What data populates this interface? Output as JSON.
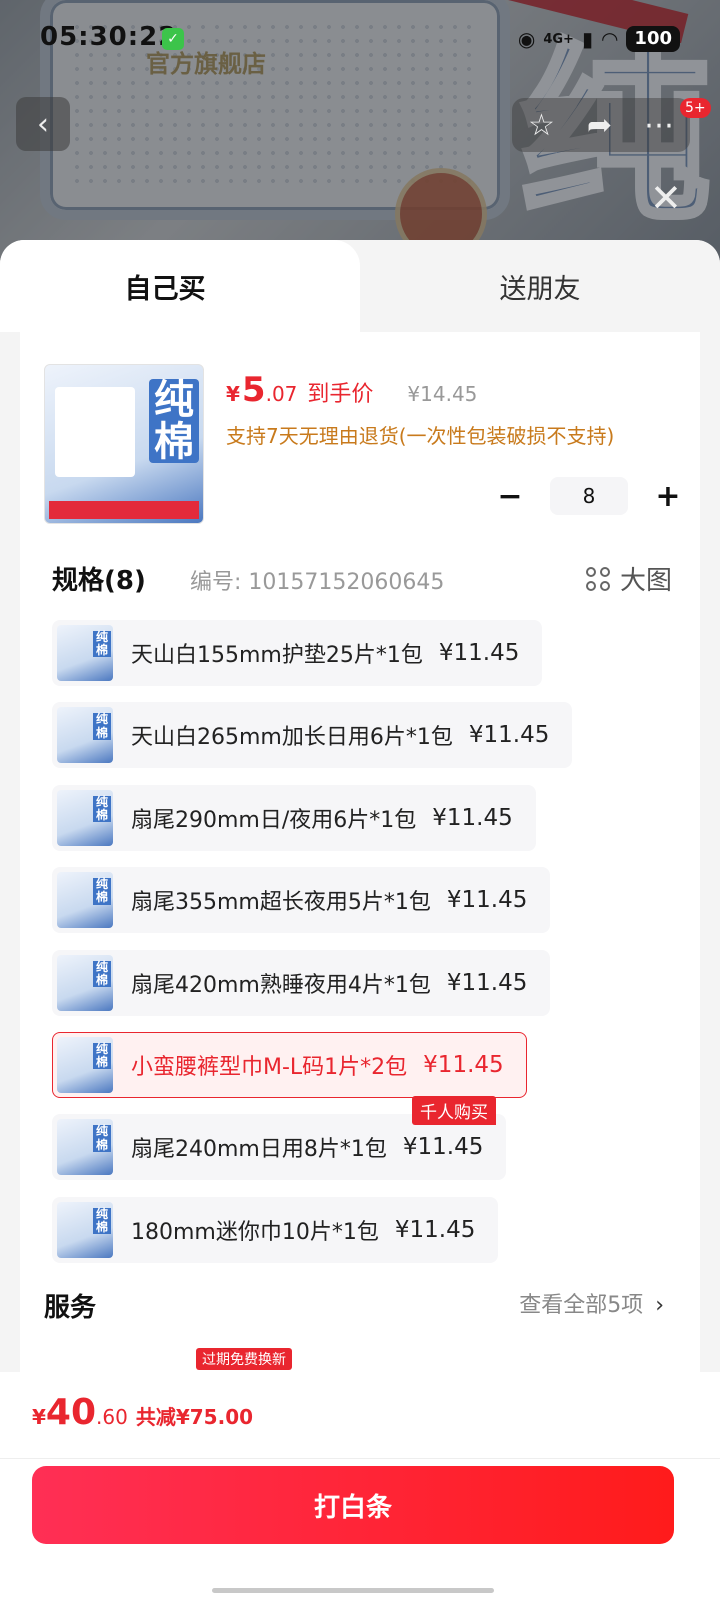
{
  "status_bar": {
    "time": "05:30:22",
    "network": "4G+",
    "battery": "100"
  },
  "banner": {
    "brand_text": "官方旗舰店",
    "big_char": "纯",
    "more_badge": "5+"
  },
  "tabs": [
    {
      "label": "自己买",
      "active": true
    },
    {
      "label": "送朋友",
      "active": false
    }
  ],
  "product": {
    "thumb_char": "纯棉",
    "price_currency": "¥",
    "price_int": "5",
    "price_dec": ".07",
    "price_label": "到手价",
    "original_price": "¥14.45",
    "return_note": "支持7天无理由退货(一次性包装破损不支持)",
    "quantity": "8"
  },
  "spec": {
    "title": "规格(8)",
    "code": "编号: 10157152060645",
    "big_image_label": "大图",
    "hot_tag": "千人购买",
    "options": [
      {
        "label": "天山白155mm护垫25片*1包",
        "price": "¥11.45",
        "selected": false
      },
      {
        "label": "天山白265mm加长日用6片*1包",
        "price": "¥11.45",
        "selected": false
      },
      {
        "label": "扇尾290mm日/夜用6片*1包",
        "price": "¥11.45",
        "selected": false
      },
      {
        "label": "扇尾355mm超长夜用5片*1包",
        "price": "¥11.45",
        "selected": false
      },
      {
        "label": "扇尾420mm熟睡夜用4片*1包",
        "price": "¥11.45",
        "selected": false
      },
      {
        "label": "小蛮腰裤型巾M-L码1片*2包",
        "price": "¥11.45",
        "selected": true
      },
      {
        "label": "扇尾240mm日用8片*1包",
        "price": "¥11.45",
        "selected": false
      },
      {
        "label": "180mm迷你巾10片*1包",
        "price": "¥11.45",
        "selected": false
      }
    ]
  },
  "service": {
    "title": "服务",
    "view_all": "查看全部5项",
    "tag": "过期免费换新"
  },
  "bottom": {
    "currency": "¥",
    "total_int": "40",
    "total_dec": ".60",
    "saving": "共减¥75.00",
    "cta_label": "打白条"
  },
  "colors": {
    "accent": "#e9262f",
    "cta_gradient_start": "#ff2f55",
    "cta_gradient_end": "#ff1b1b",
    "return_note": "#c87a1c"
  }
}
